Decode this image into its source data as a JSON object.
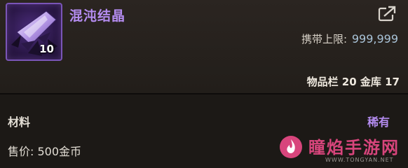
{
  "item": {
    "name": "混沌结晶",
    "count": "10",
    "icon": "crystal-icon",
    "name_color": "#b48cf0"
  },
  "carry": {
    "label": "携带上限:",
    "value": "999,999"
  },
  "storage": {
    "text": "物品栏 20 金库 17"
  },
  "details": {
    "category": "材料",
    "rarity": "稀有",
    "price": "售价: 500金币"
  },
  "actions": {
    "share_icon": "share-export-icon"
  },
  "watermark": {
    "text": "瞳焰手游网",
    "url": "WWW.TONGYAN.NET"
  }
}
